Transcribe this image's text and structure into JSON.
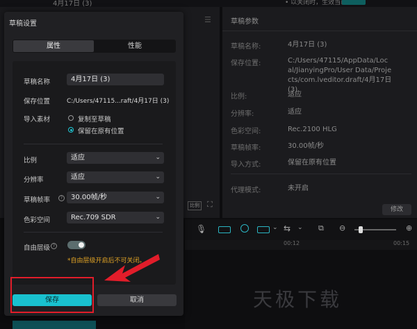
{
  "background": {
    "top_title": "4月17日 (3)",
    "top_status": "• 以关闭时，生效当已",
    "right_panel": {
      "title": "草稿参数",
      "rows": [
        {
          "label": "草稿名称:",
          "value": "4月17日 (3)"
        },
        {
          "label": "保存位置:",
          "value": "C:/Users/47115/AppData/Local/JianyingPro/User Data/Projects/com.lveditor.draft/4月17日 (3)"
        },
        {
          "label": "比例:",
          "value": "适应"
        },
        {
          "label": "分辨率:",
          "value": "适应"
        },
        {
          "label": "色彩空间:",
          "value": "Rec.2100 HLG"
        },
        {
          "label": "草稿帧率:",
          "value": "30.00帧/秒"
        },
        {
          "label": "导入方式:",
          "value": "保留在原有位置"
        },
        {
          "label": "代理模式:",
          "value": "未开启"
        }
      ],
      "edit_button": "修改"
    },
    "ruler": [
      "00:12",
      "00:15"
    ],
    "watermark": "天极下载",
    "left_toolbar_label": "比例"
  },
  "dialog": {
    "title": "草稿设置",
    "tabs": [
      {
        "label": "属性",
        "active": true
      },
      {
        "label": "性能",
        "active": false
      }
    ],
    "name_label": "草稿名称",
    "name_value": "4月17日 (3)",
    "path_label": "保存位置",
    "path_value": "C:/Users/47115...raft/4月17日 (3)",
    "import_label": "导入素材",
    "import_options": [
      {
        "label": "复制至草稿",
        "selected": false
      },
      {
        "label": "保留在原有位置",
        "selected": true
      }
    ],
    "ratio_label": "比例",
    "ratio_value": "适应",
    "resolution_label": "分辨率",
    "resolution_value": "适应",
    "fps_label": "草稿帧率",
    "fps_value": "30.00帧/秒",
    "color_label": "色彩空间",
    "color_value": "Rec.709 SDR",
    "free_layer_label": "自由层级",
    "free_layer_on": true,
    "free_layer_warning": "*自由层级开启后不可关闭。",
    "save_button": "保存",
    "cancel_button": "取消"
  },
  "colors": {
    "accent": "#19c1cf",
    "warning": "#e0a325",
    "highlight": "#e11d2a"
  }
}
